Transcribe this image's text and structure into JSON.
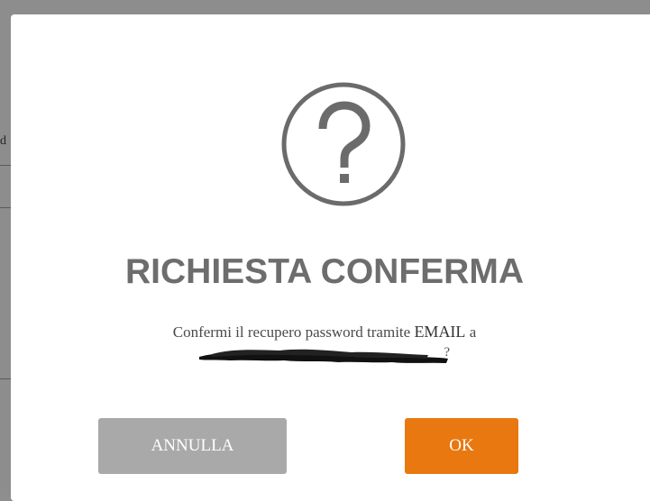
{
  "dialog": {
    "icon": "question-circle-icon",
    "title": "RICHIESTA CONFERMA",
    "message_prefix": "Confermi il recupero password tramite ",
    "message_channel": "EMAIL",
    "message_mid": " a",
    "message_suffix": "?",
    "cancel_label": "ANNULLA",
    "ok_label": "OK"
  },
  "colors": {
    "title": "#6d6d6d",
    "icon": "#6b6b6b",
    "cancel_button": "#a9a9a9",
    "ok_button": "#e8780f",
    "backdrop": "#8d8d8d"
  }
}
